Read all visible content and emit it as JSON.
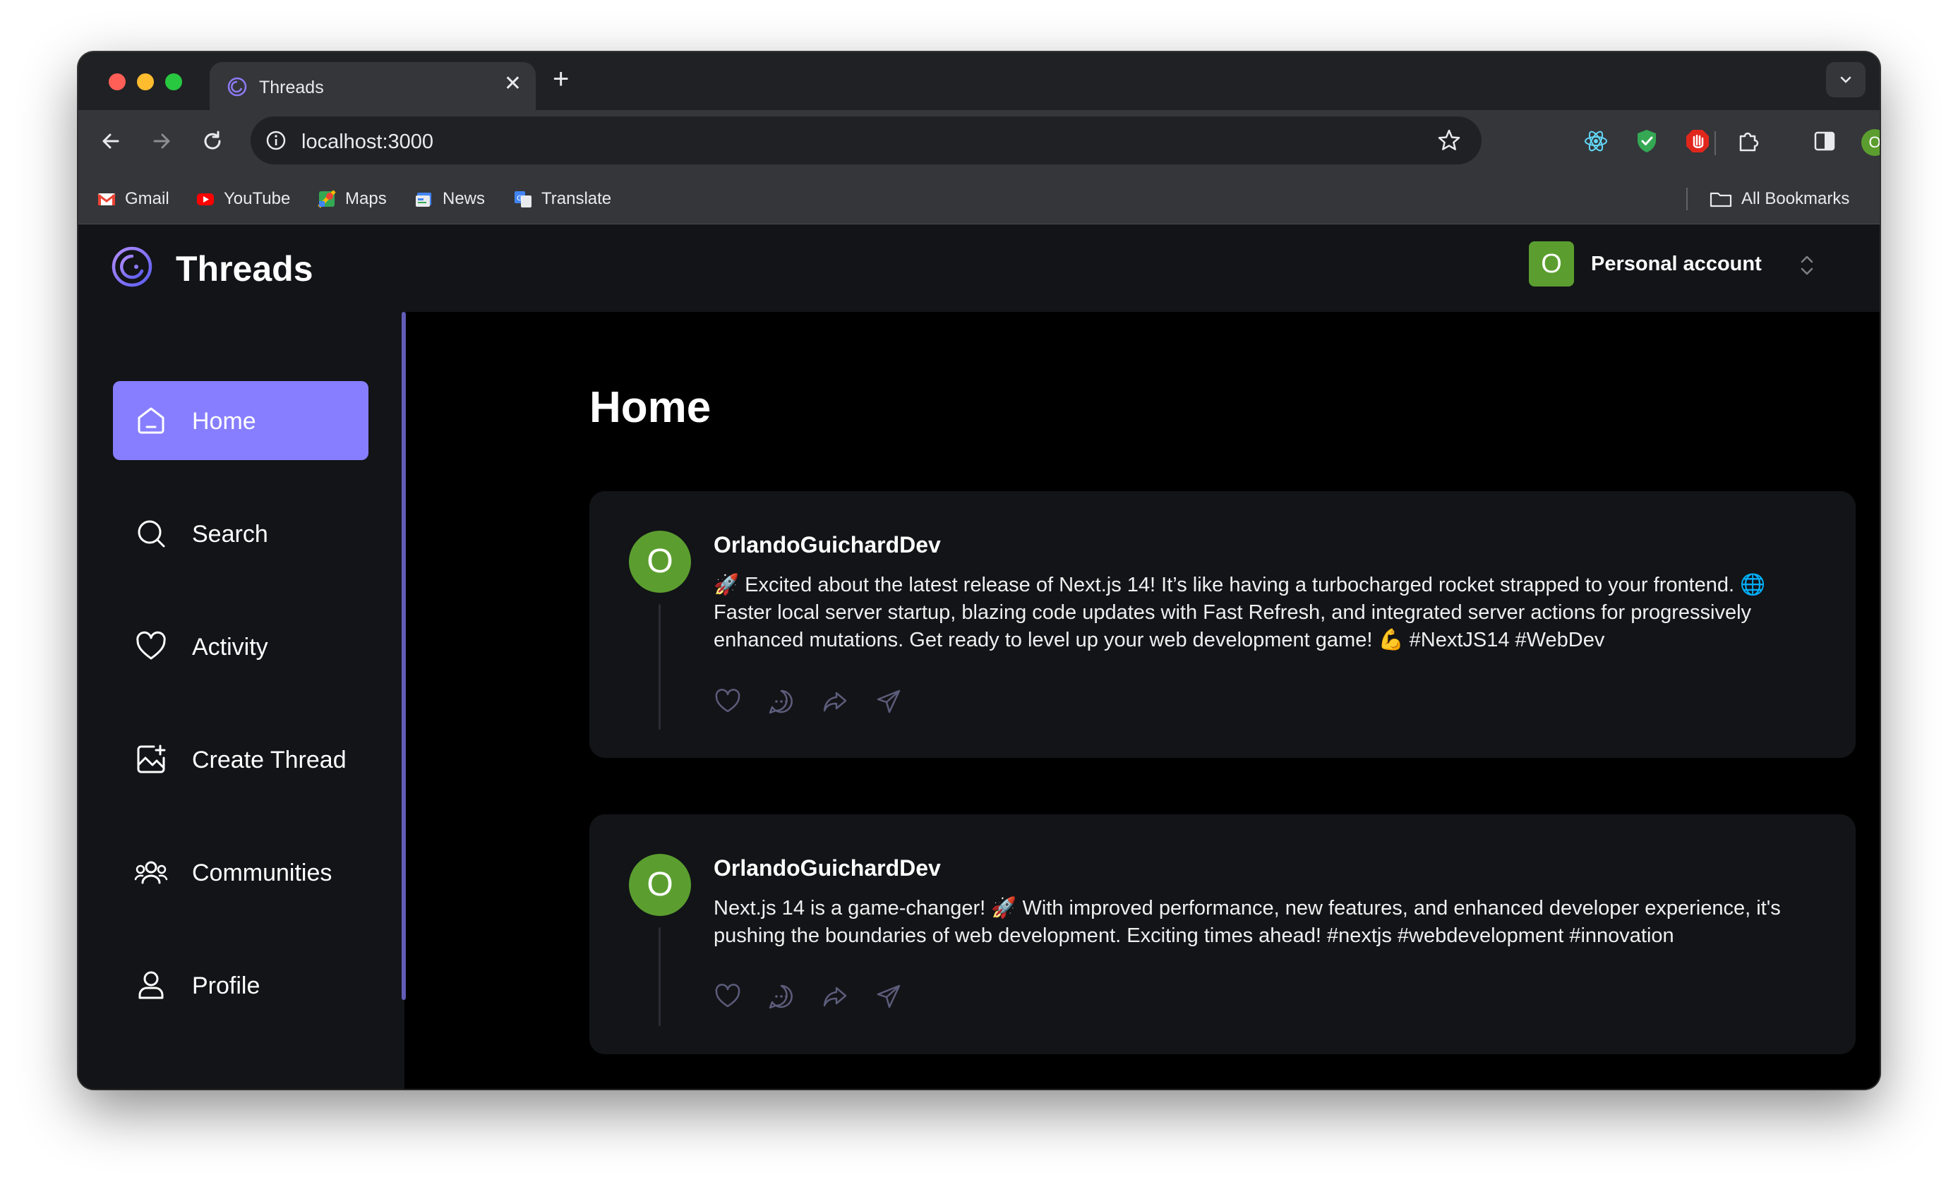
{
  "browser": {
    "tab_title": "Threads",
    "url": "localhost:3000",
    "profile_initial": "O",
    "bookmarks": [
      {
        "label": "Gmail",
        "icon": "gmail-icon"
      },
      {
        "label": "YouTube",
        "icon": "youtube-icon"
      },
      {
        "label": "Maps",
        "icon": "maps-icon"
      },
      {
        "label": "News",
        "icon": "news-icon"
      },
      {
        "label": "Translate",
        "icon": "translate-icon"
      }
    ],
    "all_bookmarks": "All Bookmarks"
  },
  "header": {
    "brand": "Threads",
    "account_initial": "O",
    "account_label": "Personal account"
  },
  "sidebar": {
    "items": [
      {
        "label": "Home",
        "icon": "home-icon",
        "active": true
      },
      {
        "label": "Search",
        "icon": "search-icon"
      },
      {
        "label": "Activity",
        "icon": "heart-icon"
      },
      {
        "label": "Create Thread",
        "icon": "create-thread-icon"
      },
      {
        "label": "Communities",
        "icon": "communities-icon"
      },
      {
        "label": "Profile",
        "icon": "profile-icon"
      }
    ]
  },
  "main": {
    "title": "Home",
    "threads": [
      {
        "avatar_initial": "O",
        "author": "OrlandoGuichardDev",
        "content": "🚀 Excited about the latest release of Next.js 14! It’s like having a turbocharged rocket strapped to your frontend. 🌐 Faster local server startup, blazing code updates with Fast Refresh, and integrated server actions for progressively enhanced mutations. Get ready to level up your web development game! 💪 #NextJS14 #WebDev"
      },
      {
        "avatar_initial": "O",
        "author": "OrlandoGuichardDev",
        "content": "Next.js 14 is a game-changer! 🚀 With improved performance, new features, and enhanced developer experience, it's pushing the boundaries of web development. Exciting times ahead! #nextjs #webdevelopment #innovation"
      }
    ]
  },
  "colors": {
    "accent": "#877eff",
    "avatar_green": "#5b9e2f",
    "panel": "#121417",
    "background": "#000000"
  }
}
